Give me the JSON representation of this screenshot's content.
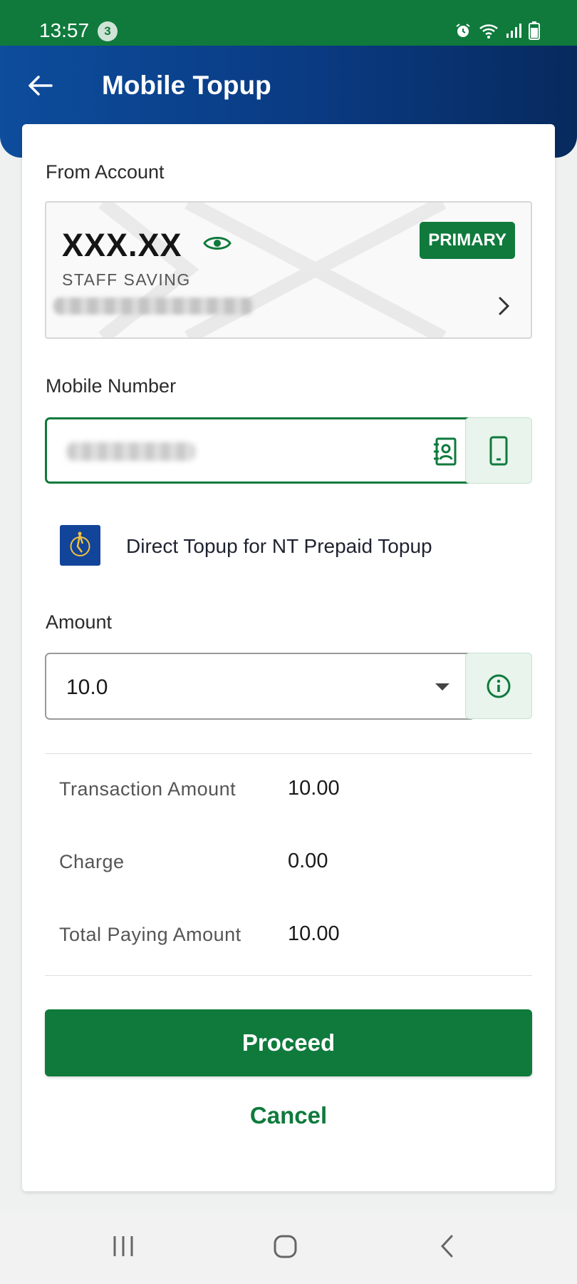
{
  "status_bar": {
    "time": "13:57",
    "notification_count": "3"
  },
  "header": {
    "title": "Mobile Topup"
  },
  "from_account": {
    "label": "From Account",
    "balance": "XXX.XX",
    "badge": "PRIMARY",
    "account_type": "STAFF SAVING"
  },
  "mobile": {
    "label": "Mobile Number"
  },
  "provider": {
    "text": "Direct Topup for NT Prepaid Topup"
  },
  "amount": {
    "label": "Amount",
    "selected": "10.0"
  },
  "summary": {
    "transaction_label": "Transaction Amount",
    "transaction_value": "10.00",
    "charge_label": "Charge",
    "charge_value": "0.00",
    "total_label": "Total Paying Amount",
    "total_value": "10.00"
  },
  "actions": {
    "proceed": "Proceed",
    "cancel": "Cancel"
  },
  "colors": {
    "brand_green": "#0f7a3c",
    "header_blue": "#0a3a82"
  },
  "icons": [
    "back-arrow-icon",
    "eye-icon",
    "chevron-right-icon",
    "contact-book-icon",
    "phone-icon",
    "info-icon",
    "alarm-icon",
    "wifi-icon",
    "signal-icon",
    "battery-icon"
  ]
}
